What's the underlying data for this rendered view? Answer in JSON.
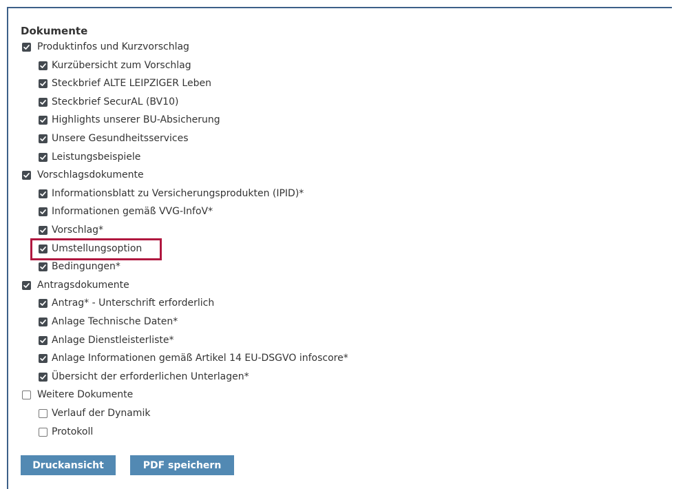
{
  "section": {
    "title": "Dokumente"
  },
  "groups": [
    {
      "label": "Produktinfos und Kurzvorschlag",
      "checked": true,
      "items": [
        {
          "label": "Kurzübersicht zum Vorschlag",
          "checked": true
        },
        {
          "label": "Steckbrief ALTE LEIPZIGER Leben",
          "checked": true
        },
        {
          "label": "Steckbrief SecurAL (BV10)",
          "checked": true
        },
        {
          "label": "Highlights unserer BU-Absicherung",
          "checked": true
        },
        {
          "label": "Unsere Gesundheitsservices",
          "checked": true
        },
        {
          "label": "Leistungsbeispiele",
          "checked": true
        }
      ]
    },
    {
      "label": "Vorschlagsdokumente",
      "checked": true,
      "items": [
        {
          "label": "Informationsblatt zu Versicherungsprodukten (IPID)*",
          "checked": true
        },
        {
          "label": "Informationen gemäß VVG-InfoV*",
          "checked": true
        },
        {
          "label": "Vorschlag*",
          "checked": true
        },
        {
          "label": "Umstellungsoption",
          "checked": true,
          "highlighted": true
        },
        {
          "label": "Bedingungen*",
          "checked": true
        }
      ]
    },
    {
      "label": "Antragsdokumente",
      "checked": true,
      "items": [
        {
          "label": "Antrag* - Unterschrift erforderlich",
          "checked": true
        },
        {
          "label": "Anlage Technische Daten*",
          "checked": true
        },
        {
          "label": "Anlage Dienstleisterliste*",
          "checked": true
        },
        {
          "label": "Anlage Informationen gemäß Artikel 14 EU-DSGVO infoscore*",
          "checked": true
        },
        {
          "label": "Übersicht der erforderlichen Unterlagen*",
          "checked": true
        }
      ]
    },
    {
      "label": "Weitere Dokumente",
      "checked": false,
      "items": [
        {
          "label": "Verlauf der Dynamik",
          "checked": false
        },
        {
          "label": "Protokoll",
          "checked": false
        }
      ]
    }
  ],
  "buttons": {
    "print_label": "Druckansicht",
    "pdf_label": "PDF speichern"
  },
  "colors": {
    "checkbox": "#444a50",
    "button": "#5289b3",
    "highlight": "#b0173f",
    "border": "#3c5f88"
  }
}
